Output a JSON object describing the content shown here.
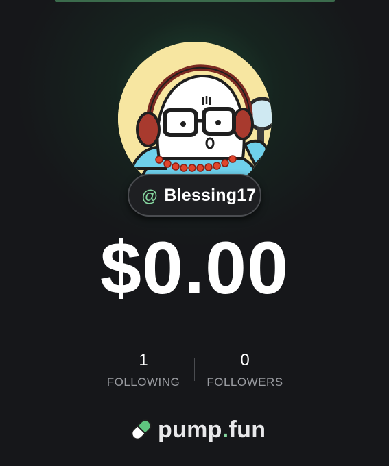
{
  "profile": {
    "at_symbol": "@",
    "handle": "Blessing17",
    "balance": "$0.00",
    "avatar_icon": "cartoon-avatar-with-headphones"
  },
  "stats": {
    "following_count": "1",
    "following_label": "FOLLOWING",
    "followers_count": "0",
    "followers_label": "FOLLOWERS"
  },
  "brand": {
    "name_main": "pump",
    "name_dot": ".",
    "name_tail": "fun",
    "icon": "pill-icon"
  },
  "colors": {
    "background": "#16171a",
    "accent_green": "#86d7a0",
    "text_primary": "#ffffff",
    "text_secondary": "#9a9ca1"
  }
}
